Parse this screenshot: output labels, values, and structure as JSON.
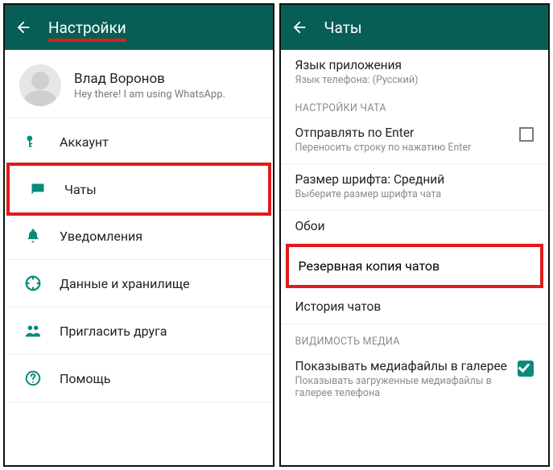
{
  "left": {
    "title": "Настройки",
    "profile": {
      "name": "Влад Воронов",
      "status": "Hey there! I am using WhatsApp."
    },
    "items": [
      {
        "icon": "key-icon",
        "label": "Аккаунт"
      },
      {
        "icon": "chat-icon",
        "label": "Чаты"
      },
      {
        "icon": "bell-icon",
        "label": "Уведомления"
      },
      {
        "icon": "data-icon",
        "label": "Данные и хранилище"
      },
      {
        "icon": "invite-icon",
        "label": "Пригласить друга"
      },
      {
        "icon": "help-icon",
        "label": "Помощь"
      }
    ]
  },
  "right": {
    "title": "Чаты",
    "lang": {
      "primary": "Язык приложения",
      "secondary": "Язык телефона: (Русский)"
    },
    "cat1": "НАСТРОЙКИ ЧАТА",
    "enter": {
      "primary": "Отправлять по Enter",
      "secondary": "Переносить строку по нажатию Enter"
    },
    "font": {
      "primary": "Размер шрифта: Средний",
      "secondary": "Выберите размер шрифта чата"
    },
    "wallpaper": "Обои",
    "backup": "Резервная копия чатов",
    "history": "История чатов",
    "cat2": "ВИДИМОСТЬ МЕДИА",
    "media": {
      "primary": "Показывать медиафайлы в галерее",
      "secondary": "Показывать загруженные медиафайлы в галерее телефона"
    }
  }
}
